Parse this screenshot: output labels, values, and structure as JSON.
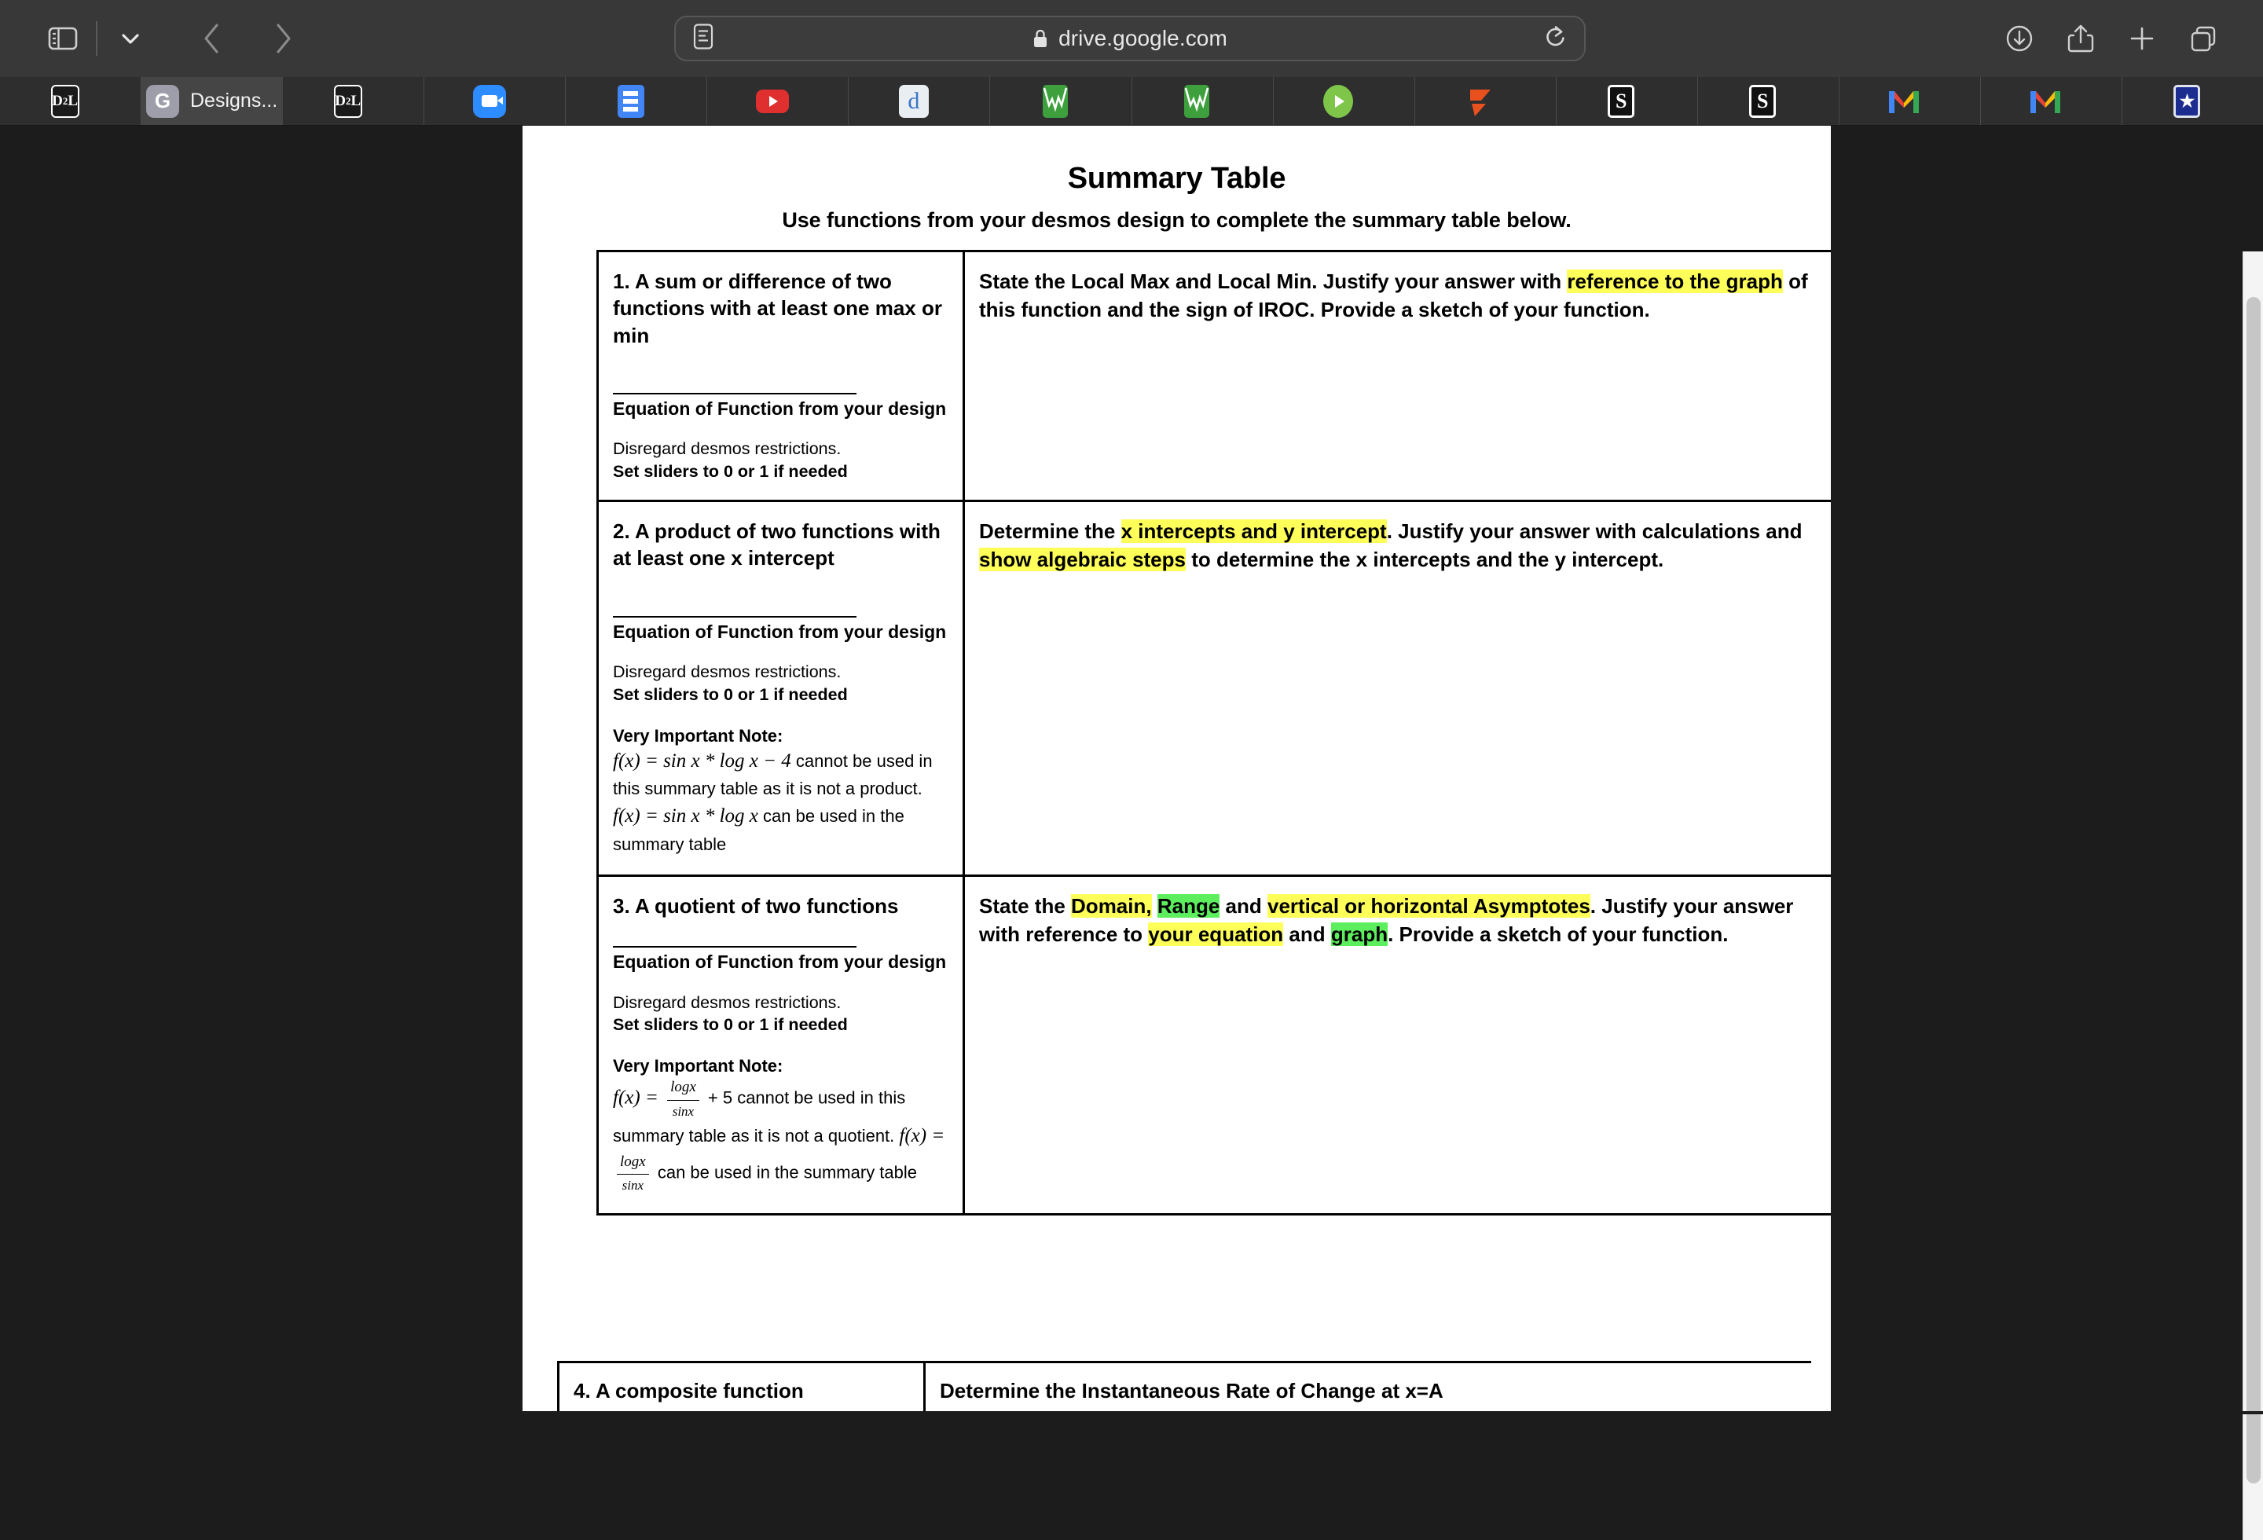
{
  "browser": {
    "toolbar_left": [
      {
        "name": "sidebar-toggle",
        "icon": "sidebar-icon"
      },
      {
        "name": "sidebar-dropdown",
        "icon": "chevron-down-icon"
      },
      {
        "name": "back-button",
        "icon": "chevron-left-icon"
      },
      {
        "name": "forward-button",
        "icon": "chevron-right-icon"
      }
    ],
    "address_bar": {
      "url": "drive.google.com",
      "lock_icon": "lock-icon",
      "reader_icon": "reader-view-icon",
      "reload_icon": "reload-icon"
    },
    "toolbar_right": [
      {
        "name": "downloads-button",
        "icon": "download-icon"
      },
      {
        "name": "share-button",
        "icon": "share-icon"
      },
      {
        "name": "new-tab-button",
        "icon": "plus-icon"
      },
      {
        "name": "tab-overview-button",
        "icon": "tab-overview-icon"
      }
    ],
    "tabs": [
      {
        "label": "",
        "favicon": "d2l-icon",
        "active": false
      },
      {
        "label": "Designs...",
        "favicon": "google-drive-g-icon",
        "active": true
      },
      {
        "label": "",
        "favicon": "d2l-icon",
        "active": false
      },
      {
        "label": "",
        "favicon": "zoom-icon",
        "active": false
      },
      {
        "label": "",
        "favicon": "google-slides-icon",
        "active": false
      },
      {
        "label": "",
        "favicon": "youtube-icon",
        "active": false
      },
      {
        "label": "",
        "favicon": "desmos-d-icon",
        "active": false
      },
      {
        "label": "",
        "favicon": "desmos-graph-icon",
        "active": false
      },
      {
        "label": "",
        "favicon": "desmos-graph-icon",
        "active": false
      },
      {
        "label": "",
        "favicon": "green-play-icon",
        "active": false
      },
      {
        "label": "",
        "favicon": "orange-flag-icon",
        "active": false
      },
      {
        "label": "",
        "favicon": "s-letter-icon",
        "active": false
      },
      {
        "label": "",
        "favicon": "s-letter-icon",
        "active": false
      },
      {
        "label": "",
        "favicon": "gmail-icon",
        "active": false
      },
      {
        "label": "",
        "favicon": "gmail-icon",
        "active": false
      },
      {
        "label": "",
        "favicon": "blue-star-icon",
        "active": false
      }
    ]
  },
  "document": {
    "title": "Summary Table",
    "subtitle": "Use functions from your desmos design to complete the summary table below.",
    "shared": {
      "equation_label": "Equation of Function from your design",
      "disregard_note": "Disregard desmos restrictions.",
      "sliders_note": "Set sliders to 0 or 1 if needed",
      "very_important_note_label": "Very Important Note:"
    },
    "rows": [
      {
        "number": "1.",
        "heading": "1. A sum or difference of two functions with at least one max or min",
        "prompt_parts": [
          {
            "text": "State the Local Max and Local Min.  Justify your answer with ",
            "hl": "none"
          },
          {
            "text": "reference to the graph",
            "hl": "yellow"
          },
          {
            "text": " of this function and the sign of IROC. Provide a sketch of your function.",
            "hl": "none"
          }
        ],
        "has_very_important_note": false
      },
      {
        "number": "2.",
        "heading": "2. A product of two functions with at least one x intercept",
        "prompt_parts": [
          {
            "text": "Determine the ",
            "hl": "none"
          },
          {
            "text": "x intercepts and y intercept",
            "hl": "yellow"
          },
          {
            "text": ".  Justify your answer with calculations and ",
            "hl": "none"
          },
          {
            "text": "show algebraic steps",
            "hl": "yellow"
          },
          {
            "text": " to determine the x intercepts and the y intercept.",
            "hl": "none"
          }
        ],
        "has_very_important_note": true,
        "note_math_1": "f(x) = sin x * log x − 4",
        "note_text_1": " cannot be used in this summary table as it is not a product. ",
        "note_math_2": "f(x) = sin x * log x",
        "note_text_2": " can be used in the summary table"
      },
      {
        "number": "3.",
        "heading": "3. A quotient of two functions",
        "prompt_parts": [
          {
            "text": "State the ",
            "hl": "none"
          },
          {
            "text": "Domain,",
            "hl": "yellow"
          },
          {
            "text": " ",
            "hl": "none"
          },
          {
            "text": "Range",
            "hl": "green"
          },
          {
            "text": " and ",
            "hl": "none"
          },
          {
            "text": "vertical or horizontal Asymptotes",
            "hl": "yellow"
          },
          {
            "text": ".  Justify your answer with reference to ",
            "hl": "none"
          },
          {
            "text": "your equation",
            "hl": "yellow"
          },
          {
            "text": " and ",
            "hl": "none"
          },
          {
            "text": "graph",
            "hl": "green"
          },
          {
            "text": ". Provide a sketch of your function.",
            "hl": "none"
          }
        ],
        "has_very_important_note": true,
        "note_frac_numerator": "logx",
        "note_frac_denominator": "sinx",
        "note_lead_1": "f(x) = ",
        "note_tail_1": " + 5 cannot be used in this summary table as it is not a quotient. ",
        "note_lead_2": "f(x) = ",
        "note_tail_2": " can be used in the summary table"
      }
    ],
    "row4_partial": {
      "heading": "4. A composite function",
      "prompt": "Determine the Instantaneous Rate of Change at x=A"
    }
  },
  "colors": {
    "highlight_yellow": "#ffff5a",
    "highlight_green": "#5dee5d",
    "chrome_bg": "#383838",
    "tabbar_bg": "#2e2e2e",
    "active_tab_bg": "#454545",
    "page_bg": "#ffffff",
    "desktop_bg": "#1c1c1c"
  }
}
